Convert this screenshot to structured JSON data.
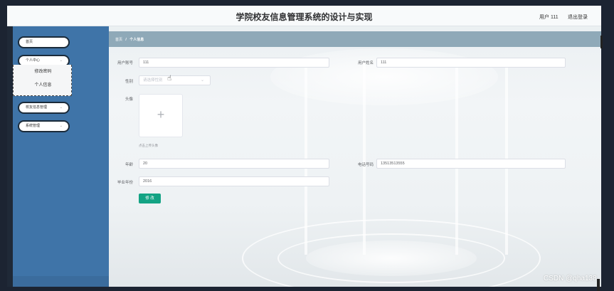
{
  "header": {
    "title": "学院校友信息管理系统的设计与实现",
    "user_label": "用户 111",
    "logout_label": "退出登录"
  },
  "sidebar": {
    "items": [
      {
        "label": "首页"
      },
      {
        "label": "个人中心",
        "chevron": "chevron-down-icon"
      },
      {
        "label": "校友信息管理",
        "chevron": "chevron-down-icon"
      },
      {
        "label": "系统管理",
        "chevron": "chevron-down-icon"
      }
    ],
    "submenu": [
      {
        "label": "修改密码"
      },
      {
        "label": "个人信息"
      }
    ]
  },
  "breadcrumb": {
    "home": "首页",
    "separator": "/",
    "current": "个人信息"
  },
  "form": {
    "account_label": "用户账号",
    "account_value": "111",
    "name_label": "用户姓名",
    "name_value": "111",
    "gender_label": "性别",
    "gender_placeholder": "请选择性别",
    "avatar_label": "头像",
    "avatar_plus": "+",
    "upload_hint": "点击上传头像",
    "age_label": "年龄",
    "age_value": "20",
    "phone_label": "电话号码",
    "phone_value": "13513513555",
    "grad_year_label": "毕业年份",
    "grad_year_value": "2016",
    "modify_button": "修 改"
  },
  "watermark": "CSDN @qha138",
  "colors": {
    "sidebar": "#3f74a8",
    "breadcrumb_bar": "#8fa9b8",
    "primary_button": "#13a384"
  }
}
